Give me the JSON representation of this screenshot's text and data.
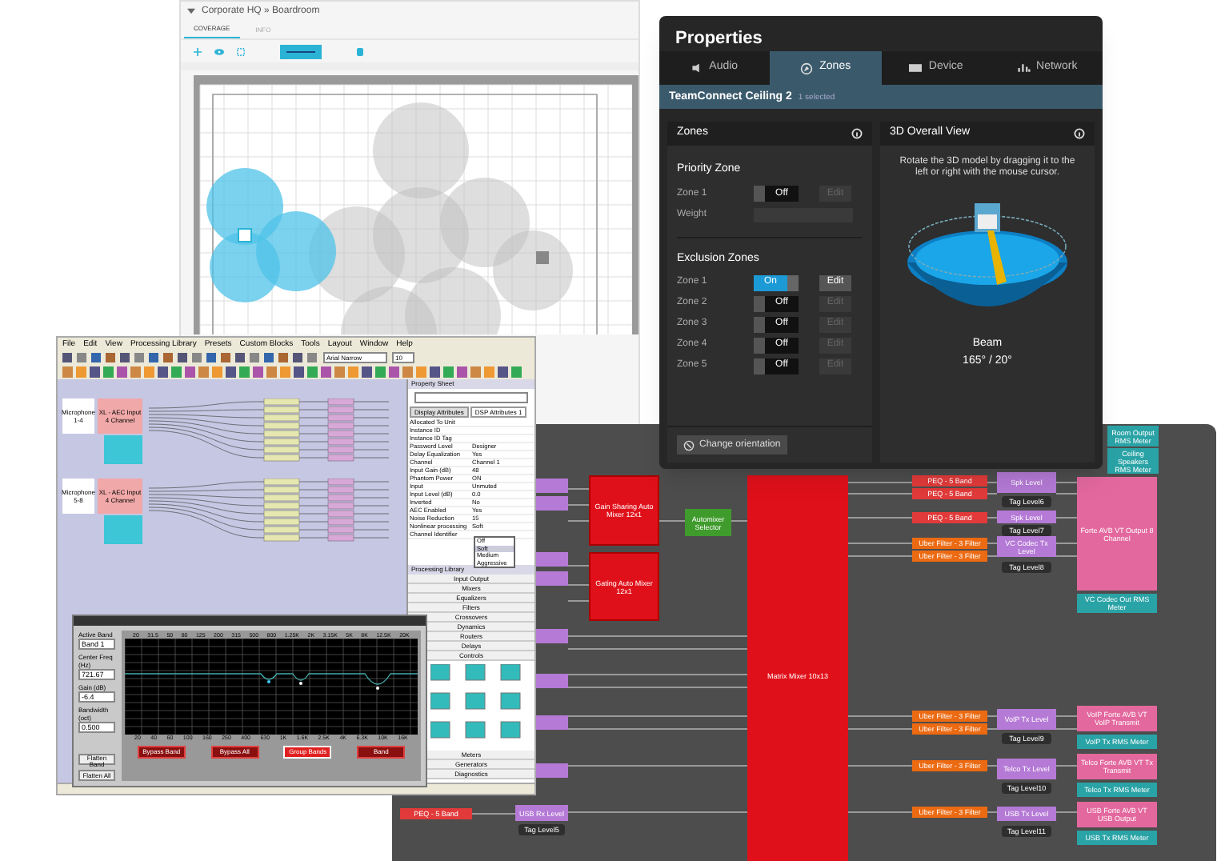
{
  "floor_plan": {
    "title": "Corporate HQ » Boardroom",
    "tabs": [
      {
        "label": "COVERAGE",
        "selected": true
      },
      {
        "label": "INFO",
        "selected": false
      }
    ]
  },
  "dsp_canvas": {
    "blocks": [
      {
        "kind": "peq",
        "label": "PEQ - 5 Band"
      },
      {
        "kind": "level",
        "label": "USB Rx Level"
      },
      {
        "kind": "tag",
        "label": "Tag Level5"
      },
      {
        "kind": "mixer",
        "label": "Gain Sharing Auto Mixer 12x1"
      },
      {
        "kind": "mixer",
        "label": "Gating Auto Mixer 12x1"
      },
      {
        "kind": "selector",
        "label": "Automixer Selector"
      },
      {
        "kind": "matrix",
        "label": "Matrix Mixer 10x13"
      },
      {
        "kind": "peq",
        "label": "PEQ - 5 Band"
      },
      {
        "kind": "peq",
        "label": "PEQ - 5 Band"
      },
      {
        "kind": "peq",
        "label": "PEQ - 5 Band"
      },
      {
        "kind": "filter",
        "label": "Uber Filter - 3 Filter"
      },
      {
        "kind": "filter",
        "label": "Uber Filter - 3 Filter"
      },
      {
        "kind": "filter",
        "label": "Uber Filter - 3 Filter"
      },
      {
        "kind": "filter",
        "label": "Uber Filter - 3 Filter"
      },
      {
        "kind": "filter",
        "label": "Uber Filter - 3 Filter"
      },
      {
        "kind": "filter",
        "label": "Uber Filter - 3 Filter"
      },
      {
        "kind": "level",
        "label": "Spk Level"
      },
      {
        "kind": "tag",
        "label": "Tag Level6"
      },
      {
        "kind": "level",
        "label": "Spk Level"
      },
      {
        "kind": "tag",
        "label": "Tag Level7"
      },
      {
        "kind": "level",
        "label": "VC Codec Tx Level"
      },
      {
        "kind": "tag",
        "label": "Tag Level8"
      },
      {
        "kind": "level",
        "label": "VoIP Tx Level"
      },
      {
        "kind": "tag",
        "label": "Tag Level9"
      },
      {
        "kind": "level",
        "label": "Telco Tx Level"
      },
      {
        "kind": "tag",
        "label": "Tag Level10"
      },
      {
        "kind": "level",
        "label": "USB Tx Level"
      },
      {
        "kind": "tag",
        "label": "Tag Level11"
      },
      {
        "kind": "meter",
        "label": "Room Output RMS Meter"
      },
      {
        "kind": "meter",
        "label": "Ceiling Speakers RMS Meter"
      },
      {
        "kind": "output",
        "label": "Forte AVB VT Output 8 Channel"
      },
      {
        "kind": "meter",
        "label": "VC Codec Out RMS Meter"
      },
      {
        "kind": "output",
        "label": "VoIP Forte AVB VT VoIP Transmit"
      },
      {
        "kind": "meter",
        "label": "VoIP Tx RMS Meter"
      },
      {
        "kind": "output",
        "label": "Telco Forte AVB VT Tx Transmit"
      },
      {
        "kind": "meter",
        "label": "Telco Tx RMS Meter"
      },
      {
        "kind": "output",
        "label": "USB Forte AVB VT USB Output"
      },
      {
        "kind": "meter",
        "label": "USB Tx RMS Meter"
      }
    ]
  },
  "properties": {
    "title": "Properties",
    "tabs": [
      {
        "label": "Audio",
        "selected": false
      },
      {
        "label": "Zones",
        "selected": true
      },
      {
        "label": "Device",
        "selected": false
      },
      {
        "label": "Network",
        "selected": false
      }
    ],
    "device": "TeamConnect Ceiling 2",
    "selection": "1 selected",
    "zones_panel": {
      "title": "Zones",
      "priority_heading": "Priority Zone",
      "priority": {
        "label": "Zone 1",
        "on": false,
        "toggle": "Off",
        "edit": "Edit"
      },
      "weight_label": "Weight",
      "exclusion_heading": "Exclusion Zones",
      "exclusion": [
        {
          "label": "Zone 1",
          "on": true,
          "toggle": "On",
          "edit": "Edit"
        },
        {
          "label": "Zone 2",
          "on": false,
          "toggle": "Off",
          "edit": "Edit"
        },
        {
          "label": "Zone 3",
          "on": false,
          "toggle": "Off",
          "edit": "Edit"
        },
        {
          "label": "Zone 4",
          "on": false,
          "toggle": "Off",
          "edit": "Edit"
        },
        {
          "label": "Zone 5",
          "on": false,
          "toggle": "Off",
          "edit": "Edit"
        }
      ],
      "button": "Change orientation"
    },
    "view_panel": {
      "title": "3D Overall View",
      "hint": "Rotate the 3D model by dragging it to the left or right with the mouse cursor.",
      "beam_label": "Beam",
      "beam_value": "165° / 20°"
    }
  },
  "designer": {
    "menu": [
      "File",
      "Edit",
      "View",
      "Processing Library",
      "Presets",
      "Custom Blocks",
      "Tools",
      "Layout",
      "Window",
      "Help"
    ],
    "font": "Arial Narrow",
    "font_size": "10",
    "groups": [
      {
        "mic": "Microphone 1-4",
        "aec": "XL - AEC Input 4 Channel"
      },
      {
        "mic": "Microphone 5-8",
        "aec": "XL - AEC Input 4 Channel"
      }
    ],
    "property_sheet": {
      "title": "Property Sheet",
      "tabs": [
        {
          "label": "Display Attributes",
          "selected": false
        },
        {
          "label": "DSP Attributes 1",
          "selected": true
        }
      ],
      "rows": [
        {
          "name": "Allocated To Unit"
        },
        {
          "name": "Instance ID"
        },
        {
          "name": "Instance ID Tag"
        },
        {
          "name": "Password Level",
          "value": "Designer"
        },
        {
          "name": "Delay Equalization",
          "value": "Yes"
        },
        {
          "name": "Channel",
          "value": "Channel 1"
        },
        {
          "name": "Input Gain (dB)",
          "value": "48"
        },
        {
          "name": "Phantom Power",
          "value": "ON"
        },
        {
          "name": "Input",
          "value": "Unmuted"
        },
        {
          "name": "Input Level (dB)",
          "value": "0.0"
        },
        {
          "name": "Inverted",
          "value": "No"
        },
        {
          "name": "AEC Enabled",
          "value": "Yes"
        },
        {
          "name": "Noise Reduction",
          "value": "15"
        },
        {
          "name": "Nonlinear processing",
          "value": "Soft"
        },
        {
          "name": "Channel Identifier"
        }
      ],
      "options": [
        {
          "label": "Off",
          "selected": false
        },
        {
          "label": "Soft",
          "selected": true
        },
        {
          "label": "Medium",
          "selected": false
        },
        {
          "label": "Aggressive",
          "selected": false
        }
      ]
    },
    "library": {
      "title": "Processing Library",
      "categories": [
        "Input Output",
        "Mixers",
        "Equalizers",
        "Filters",
        "Crossovers",
        "Dynamics",
        "Routers",
        "Delays",
        "Controls"
      ],
      "more_categories": [
        "Meters",
        "Generators",
        "Diagnostics"
      ]
    }
  },
  "equalizer": {
    "fields": [
      {
        "label": "Active Band",
        "value": "Band 1"
      },
      {
        "label": "Center Freq (Hz)",
        "value": "721.67"
      },
      {
        "label": "Gain (dB)",
        "value": "-6.4"
      },
      {
        "label": "Bandwidth (oct)",
        "value": "0.500"
      }
    ],
    "side_buttons": [
      "Flatten Band",
      "Flatten All"
    ],
    "top_axis": [
      "20",
      "31.5",
      "50",
      "80",
      "125",
      "200",
      "315",
      "500",
      "800",
      "1.25K",
      "2K",
      "3.15K",
      "5K",
      "8K",
      "12.5K",
      "20K"
    ],
    "bottom_axis": [
      "20",
      "40",
      "60",
      "100",
      "160",
      "250",
      "400",
      "630",
      "1K",
      "1.6K",
      "2.5K",
      "4K",
      "6.3K",
      "10K",
      "16K"
    ],
    "buttons": [
      {
        "label": "Bypass Band",
        "selected": false
      },
      {
        "label": "Bypass All",
        "selected": false
      },
      {
        "label": "Group Bands",
        "selected": true
      },
      {
        "label": "Band",
        "selected": false
      }
    ]
  }
}
